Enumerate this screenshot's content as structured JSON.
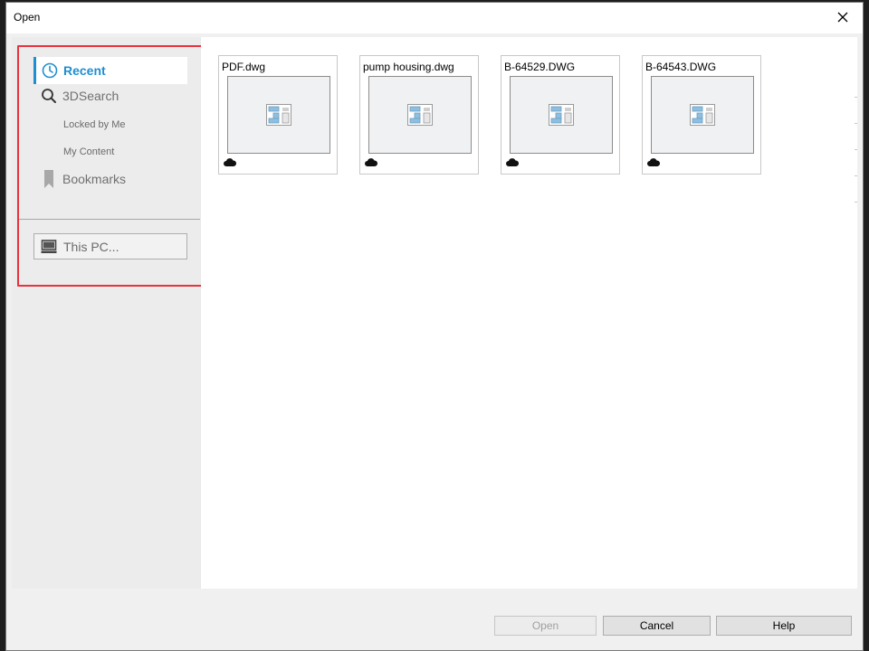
{
  "window": {
    "title": "Open"
  },
  "nav": {
    "recent": "Recent",
    "search": "3DSearch",
    "locked_by_me": "Locked by Me",
    "my_content": "My Content",
    "bookmarks": "Bookmarks",
    "this_pc": "This PC..."
  },
  "files": [
    {
      "name": "PDF.dwg",
      "icon": "drawing-icon",
      "status_icon": "cloud-icon"
    },
    {
      "name": "pump housing.dwg",
      "icon": "drawing-icon",
      "status_icon": "cloud-icon"
    },
    {
      "name": "B-64529.DWG",
      "icon": "drawing-icon",
      "status_icon": "cloud-icon"
    },
    {
      "name": "B-64543.DWG",
      "icon": "drawing-icon",
      "status_icon": "cloud-icon"
    }
  ],
  "buttons": {
    "open": "Open",
    "cancel": "Cancel",
    "help": "Help"
  },
  "colors": {
    "accent": "#1f8fcf",
    "highlight_border": "#e8323c"
  }
}
